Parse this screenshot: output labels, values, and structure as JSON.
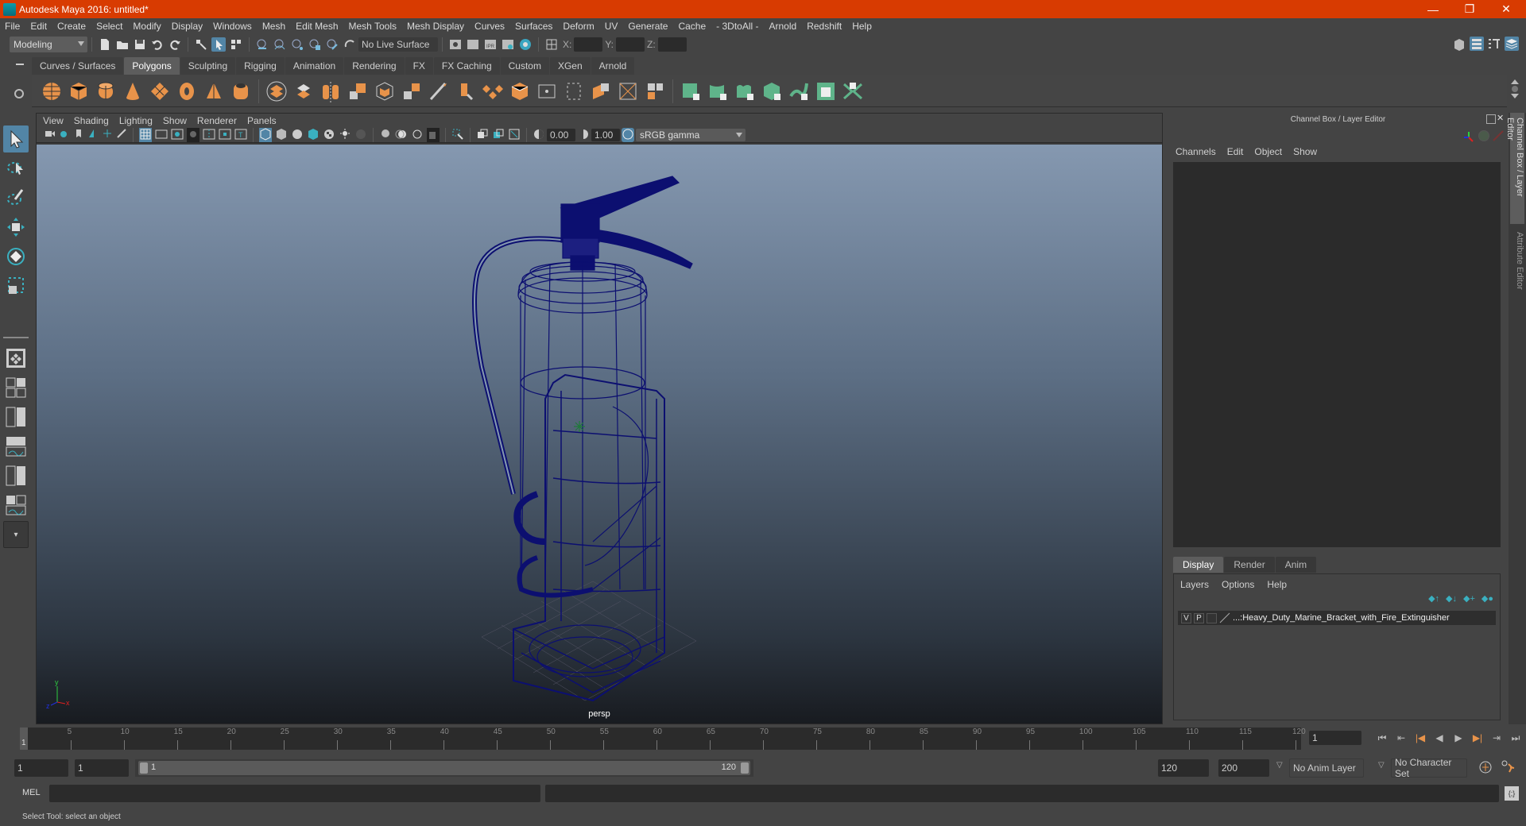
{
  "window": {
    "title": "Autodesk Maya 2016: untitled*",
    "minimize": "—",
    "restore": "❐",
    "close": "✕"
  },
  "menubar": [
    "File",
    "Edit",
    "Create",
    "Select",
    "Modify",
    "Display",
    "Windows",
    "Mesh",
    "Edit Mesh",
    "Mesh Tools",
    "Mesh Display",
    "Curves",
    "Surfaces",
    "Deform",
    "UV",
    "Generate",
    "Cache",
    "- 3DtoAll -",
    "Arnold",
    "Redshift",
    "Help"
  ],
  "statusline": {
    "menuset": "Modeling",
    "live_surface": "No Live Surface",
    "x_label": "X:",
    "y_label": "Y:",
    "z_label": "Z:",
    "x_value": "",
    "y_value": "",
    "z_value": ""
  },
  "shelf": {
    "tabs": [
      "Curves / Surfaces",
      "Polygons",
      "Sculpting",
      "Rigging",
      "Animation",
      "Rendering",
      "FX",
      "FX Caching",
      "Custom",
      "XGen",
      "Arnold"
    ],
    "active_tab": "Polygons",
    "icons_primitives": [
      "poly-sphere-icon",
      "poly-cube-icon",
      "poly-cylinder-icon",
      "poly-cone-icon",
      "poly-plane-icon",
      "poly-torus-icon",
      "poly-pyramid-icon",
      "poly-pipe-icon"
    ],
    "icons_tools": [
      "combine-icon",
      "separate-icon",
      "mirror-icon",
      "smooth-icon",
      "bevel-icon",
      "extrude-icon",
      "bridge-icon",
      "multicut-icon",
      "append-icon",
      "merge-icon",
      "fill-hole-icon",
      "bridge-edge-icon",
      "triangulate-icon",
      "quadrangulate-icon",
      "separate-faces-icon",
      "uv-layout-icon"
    ],
    "icons_uv": [
      "planar-uv-icon",
      "cylindrical-uv-icon",
      "spherical-uv-icon",
      "automatic-uv-icon",
      "contour-stretch-uv-icon",
      "uv-editor-icon",
      "unfold-uv-icon"
    ],
    "accent_orange": "#e8934a",
    "accent_green": "#5fb48a"
  },
  "viewport": {
    "menu": [
      "View",
      "Shading",
      "Lighting",
      "Show",
      "Renderer",
      "Panels"
    ],
    "exposure": "0.00",
    "gamma": "1.00",
    "color_space": "sRGB gamma",
    "camera_label": "persp",
    "axis": {
      "x": "x",
      "y": "y",
      "z": "z"
    },
    "wireframe_color": "#0c0f70"
  },
  "right_panel": {
    "title": "Channel Box / Layer Editor",
    "channel_menu": [
      "Channels",
      "Edit",
      "Object",
      "Show"
    ],
    "layer_tabs": [
      "Display",
      "Render",
      "Anim"
    ],
    "active_layer_tab": "Display",
    "layer_menu": [
      "Layers",
      "Options",
      "Help"
    ],
    "layers": [
      {
        "visible": "V",
        "playback": "P",
        "name": "...:Heavy_Duty_Marine_Bracket_with_Fire_Extinguisher"
      }
    ]
  },
  "side_tabs": [
    "Channel Box / Layer Editor",
    "Attribute Editor"
  ],
  "timeline": {
    "ticks": [
      5,
      10,
      15,
      20,
      25,
      30,
      35,
      40,
      45,
      50,
      55,
      60,
      65,
      70,
      75,
      80,
      85,
      90,
      95,
      100,
      105,
      110,
      115,
      120
    ],
    "start": 1,
    "end": 120,
    "current_frame_marker": "1",
    "current_frame": "1"
  },
  "range": {
    "start_time": "1",
    "playback_start": "1",
    "slider_start": "1",
    "slider_end": "120",
    "playback_end": "120",
    "end_time": "200",
    "anim_layer": "No Anim Layer",
    "character_set": "No Character Set"
  },
  "command_line": {
    "label": "MEL",
    "input": "",
    "output": ""
  },
  "help_line": "Select Tool: select an object"
}
